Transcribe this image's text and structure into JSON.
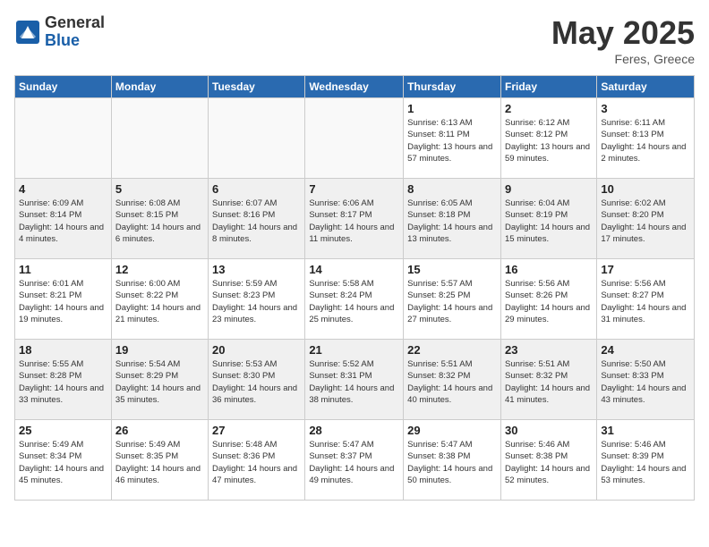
{
  "header": {
    "logo_general": "General",
    "logo_blue": "Blue",
    "month": "May 2025",
    "location": "Feres, Greece"
  },
  "days_of_week": [
    "Sunday",
    "Monday",
    "Tuesday",
    "Wednesday",
    "Thursday",
    "Friday",
    "Saturday"
  ],
  "weeks": [
    [
      {
        "day": "",
        "info": "",
        "empty": true
      },
      {
        "day": "",
        "info": "",
        "empty": true
      },
      {
        "day": "",
        "info": "",
        "empty": true
      },
      {
        "day": "",
        "info": "",
        "empty": true
      },
      {
        "day": "1",
        "info": "Sunrise: 6:13 AM\nSunset: 8:11 PM\nDaylight: 13 hours and 57 minutes.",
        "empty": false
      },
      {
        "day": "2",
        "info": "Sunrise: 6:12 AM\nSunset: 8:12 PM\nDaylight: 13 hours and 59 minutes.",
        "empty": false
      },
      {
        "day": "3",
        "info": "Sunrise: 6:11 AM\nSunset: 8:13 PM\nDaylight: 14 hours and 2 minutes.",
        "empty": false
      }
    ],
    [
      {
        "day": "4",
        "info": "Sunrise: 6:09 AM\nSunset: 8:14 PM\nDaylight: 14 hours and 4 minutes.",
        "empty": false
      },
      {
        "day": "5",
        "info": "Sunrise: 6:08 AM\nSunset: 8:15 PM\nDaylight: 14 hours and 6 minutes.",
        "empty": false
      },
      {
        "day": "6",
        "info": "Sunrise: 6:07 AM\nSunset: 8:16 PM\nDaylight: 14 hours and 8 minutes.",
        "empty": false
      },
      {
        "day": "7",
        "info": "Sunrise: 6:06 AM\nSunset: 8:17 PM\nDaylight: 14 hours and 11 minutes.",
        "empty": false
      },
      {
        "day": "8",
        "info": "Sunrise: 6:05 AM\nSunset: 8:18 PM\nDaylight: 14 hours and 13 minutes.",
        "empty": false
      },
      {
        "day": "9",
        "info": "Sunrise: 6:04 AM\nSunset: 8:19 PM\nDaylight: 14 hours and 15 minutes.",
        "empty": false
      },
      {
        "day": "10",
        "info": "Sunrise: 6:02 AM\nSunset: 8:20 PM\nDaylight: 14 hours and 17 minutes.",
        "empty": false
      }
    ],
    [
      {
        "day": "11",
        "info": "Sunrise: 6:01 AM\nSunset: 8:21 PM\nDaylight: 14 hours and 19 minutes.",
        "empty": false
      },
      {
        "day": "12",
        "info": "Sunrise: 6:00 AM\nSunset: 8:22 PM\nDaylight: 14 hours and 21 minutes.",
        "empty": false
      },
      {
        "day": "13",
        "info": "Sunrise: 5:59 AM\nSunset: 8:23 PM\nDaylight: 14 hours and 23 minutes.",
        "empty": false
      },
      {
        "day": "14",
        "info": "Sunrise: 5:58 AM\nSunset: 8:24 PM\nDaylight: 14 hours and 25 minutes.",
        "empty": false
      },
      {
        "day": "15",
        "info": "Sunrise: 5:57 AM\nSunset: 8:25 PM\nDaylight: 14 hours and 27 minutes.",
        "empty": false
      },
      {
        "day": "16",
        "info": "Sunrise: 5:56 AM\nSunset: 8:26 PM\nDaylight: 14 hours and 29 minutes.",
        "empty": false
      },
      {
        "day": "17",
        "info": "Sunrise: 5:56 AM\nSunset: 8:27 PM\nDaylight: 14 hours and 31 minutes.",
        "empty": false
      }
    ],
    [
      {
        "day": "18",
        "info": "Sunrise: 5:55 AM\nSunset: 8:28 PM\nDaylight: 14 hours and 33 minutes.",
        "empty": false
      },
      {
        "day": "19",
        "info": "Sunrise: 5:54 AM\nSunset: 8:29 PM\nDaylight: 14 hours and 35 minutes.",
        "empty": false
      },
      {
        "day": "20",
        "info": "Sunrise: 5:53 AM\nSunset: 8:30 PM\nDaylight: 14 hours and 36 minutes.",
        "empty": false
      },
      {
        "day": "21",
        "info": "Sunrise: 5:52 AM\nSunset: 8:31 PM\nDaylight: 14 hours and 38 minutes.",
        "empty": false
      },
      {
        "day": "22",
        "info": "Sunrise: 5:51 AM\nSunset: 8:32 PM\nDaylight: 14 hours and 40 minutes.",
        "empty": false
      },
      {
        "day": "23",
        "info": "Sunrise: 5:51 AM\nSunset: 8:32 PM\nDaylight: 14 hours and 41 minutes.",
        "empty": false
      },
      {
        "day": "24",
        "info": "Sunrise: 5:50 AM\nSunset: 8:33 PM\nDaylight: 14 hours and 43 minutes.",
        "empty": false
      }
    ],
    [
      {
        "day": "25",
        "info": "Sunrise: 5:49 AM\nSunset: 8:34 PM\nDaylight: 14 hours and 45 minutes.",
        "empty": false
      },
      {
        "day": "26",
        "info": "Sunrise: 5:49 AM\nSunset: 8:35 PM\nDaylight: 14 hours and 46 minutes.",
        "empty": false
      },
      {
        "day": "27",
        "info": "Sunrise: 5:48 AM\nSunset: 8:36 PM\nDaylight: 14 hours and 47 minutes.",
        "empty": false
      },
      {
        "day": "28",
        "info": "Sunrise: 5:47 AM\nSunset: 8:37 PM\nDaylight: 14 hours and 49 minutes.",
        "empty": false
      },
      {
        "day": "29",
        "info": "Sunrise: 5:47 AM\nSunset: 8:38 PM\nDaylight: 14 hours and 50 minutes.",
        "empty": false
      },
      {
        "day": "30",
        "info": "Sunrise: 5:46 AM\nSunset: 8:38 PM\nDaylight: 14 hours and 52 minutes.",
        "empty": false
      },
      {
        "day": "31",
        "info": "Sunrise: 5:46 AM\nSunset: 8:39 PM\nDaylight: 14 hours and 53 minutes.",
        "empty": false
      }
    ]
  ]
}
